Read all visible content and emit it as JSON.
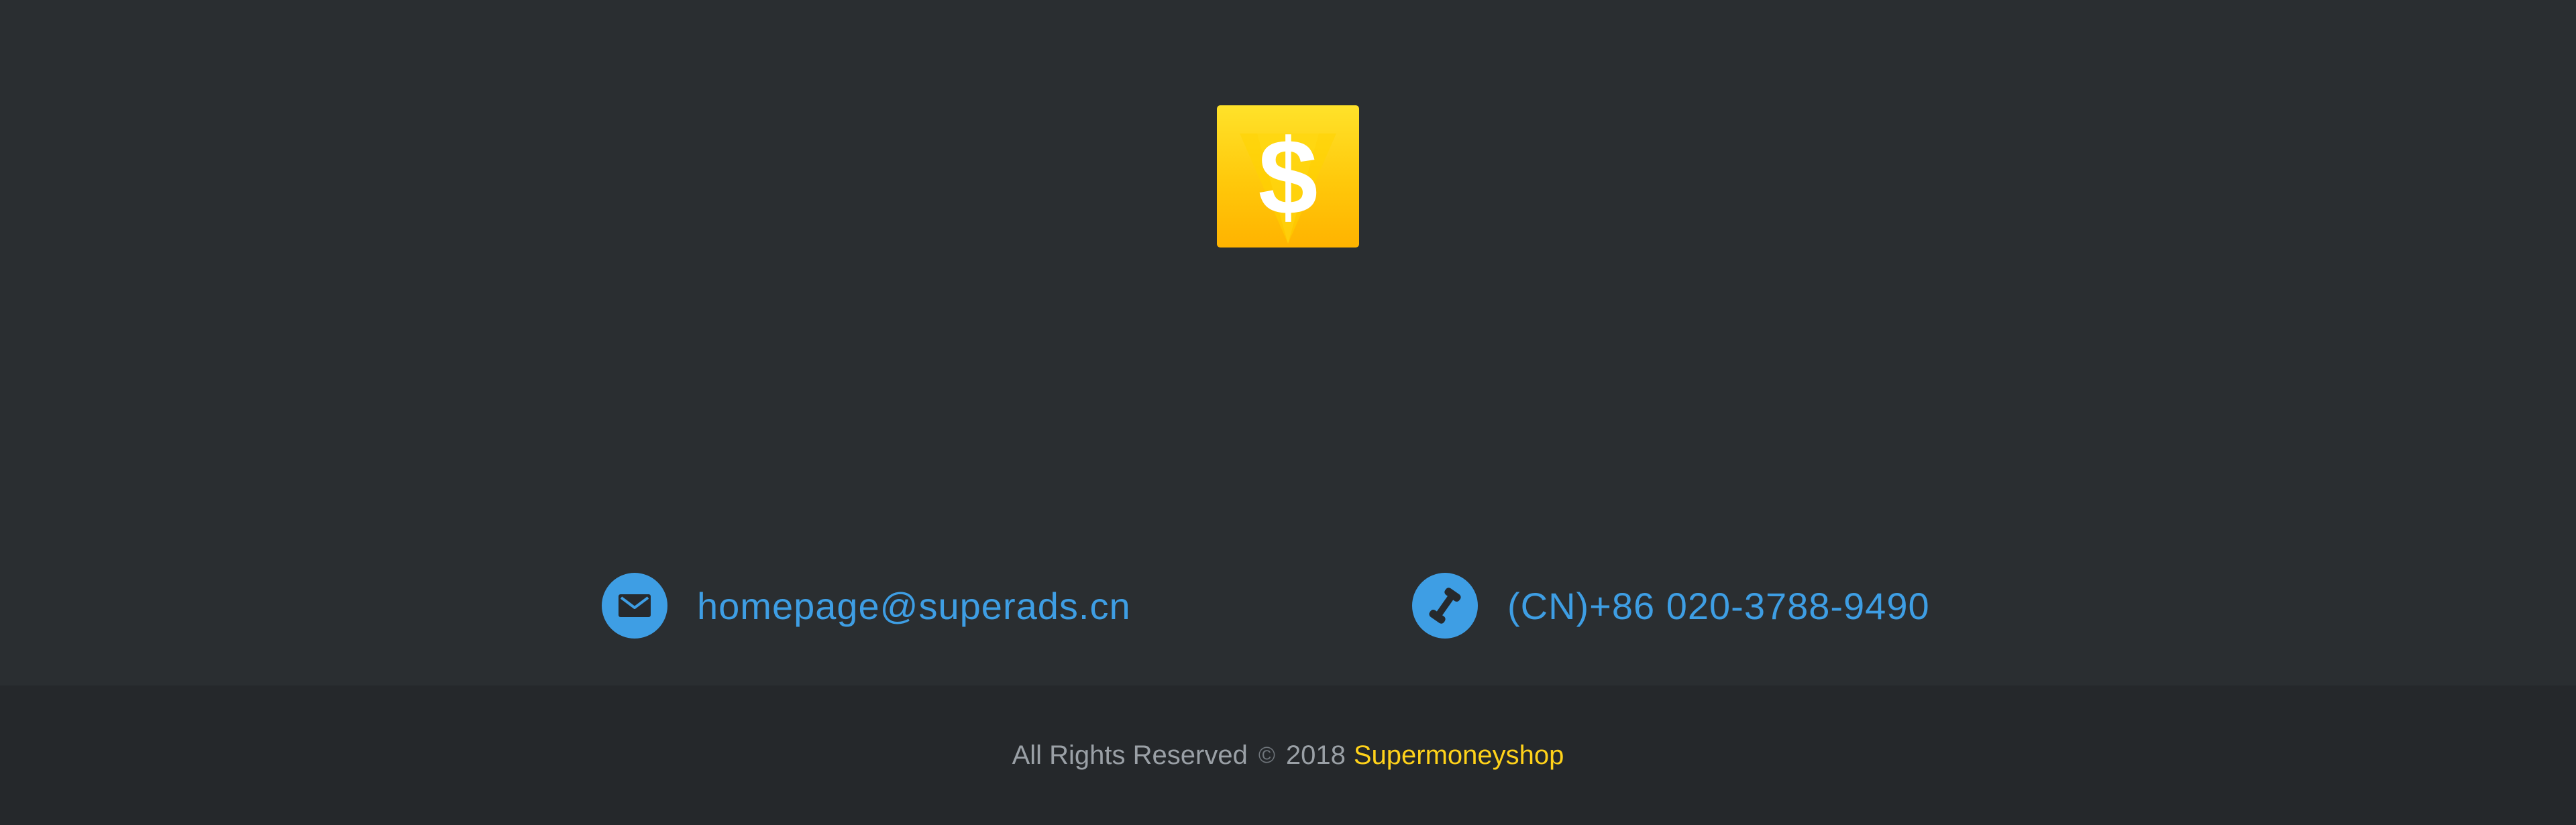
{
  "logo": {
    "icon": "dollar-diamond-icon",
    "symbol": "$",
    "colors": {
      "top": "#ffe22a",
      "bottom": "#ffb300",
      "symbol": "#ffffff"
    }
  },
  "contacts": {
    "email": {
      "icon": "envelope-icon",
      "text": "homepage@superads.cn"
    },
    "phone": {
      "icon": "phone-icon",
      "text": "(CN)+86 020-3788-9490"
    }
  },
  "footer": {
    "rights_text": "All Rights Reserved",
    "copyright_symbol": "©",
    "year": "2018",
    "brand": "Supermoneyshop"
  },
  "colors": {
    "background": "#2a2e31",
    "footer_background": "#25282b",
    "accent_blue": "#3e9ee4",
    "brand_yellow": "#ffd21a"
  }
}
